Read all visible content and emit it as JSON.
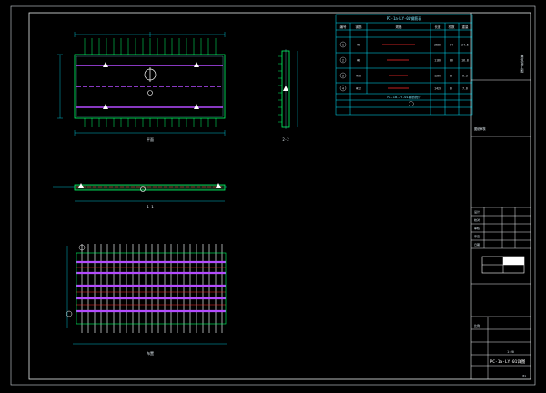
{
  "colors": {
    "background": "#000000",
    "frame": "#ffffff",
    "steel": "#00ff66",
    "rebar_main": "#ffffff",
    "rebar_cross": "#b44bff",
    "dimension": "#00e5ff",
    "highlight": "#ff2a2a",
    "table_line": "#00e5ff",
    "text": "#dfe9ef"
  },
  "drawing": {
    "plan_label": "平面",
    "elevation_label": "1-1",
    "section_label": "2-2",
    "layout_label": "布置"
  },
  "table": {
    "title": "PC-1a-LY-01钢筋表",
    "headers": [
      "编号",
      "钢筋",
      "规格",
      "长度",
      "根数",
      "重量"
    ],
    "summary_title": "PC-1a-LY-01钢筋统计",
    "rows": [
      {
        "no": "1",
        "spec": "Φ8",
        "len": "2580",
        "count": "24",
        "wt": "24.5"
      },
      {
        "no": "2",
        "spec": "Φ8",
        "len": "1180",
        "count": "36",
        "wt": "16.8"
      },
      {
        "no": "3",
        "spec": "Φ10",
        "len": "1260",
        "count": "8",
        "wt": "6.2"
      },
      {
        "no": "4",
        "spec": "Φ12",
        "len": "1420",
        "count": "6",
        "wt": "7.6"
      }
    ]
  },
  "title_block": {
    "stamp": "图纸审核",
    "company_mark": "建筑施工图",
    "drawing_no": "PC-1a-LY-01详图",
    "scale": "1:20",
    "sheet": "01",
    "rows": [
      "设计",
      "校对",
      "审核",
      "审定",
      "日期",
      "比例"
    ]
  }
}
